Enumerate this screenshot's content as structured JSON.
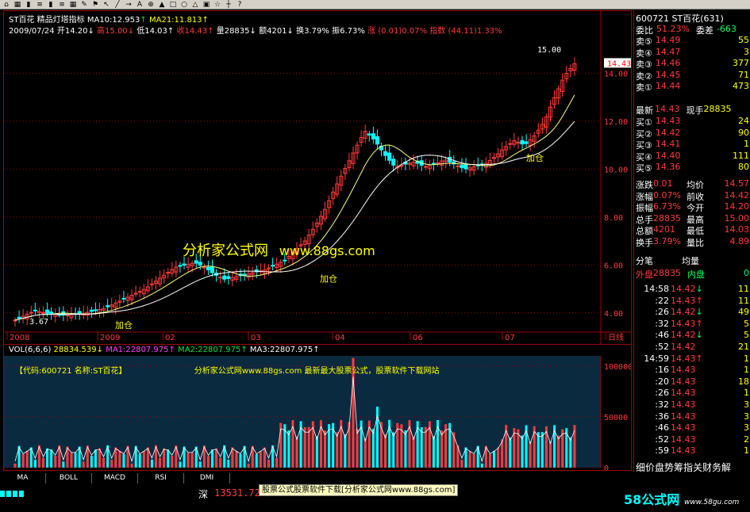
{
  "toolbar": {
    "icons": [
      "home-icon",
      "grid-icon",
      "bars-icon",
      "list-icon",
      "bars-icon",
      "list-icon",
      "grid-icon",
      "pen-icon",
      "flag-icon",
      "cursor-icon",
      "line-icon",
      "arrow-icon",
      "text-icon",
      "zoom-icon",
      "chart-icon",
      "square-icon",
      "circle-icon",
      "tri-icon",
      "lock-icon",
      "star-icon",
      "ruler-icon",
      "help-icon"
    ]
  },
  "header": {
    "stock_name": "ST百花",
    "indicator": "精品灯塔指标",
    "ma10": "MA10:12.953",
    "ma21": "MA21:11.813",
    "date": "2009/07/24",
    "open": "开14.20",
    "high": "高15.00",
    "low": "低14.03",
    "close": "收14.43",
    "volume": "量28835",
    "amount": "额4201",
    "turnover": "换3.79%",
    "amplitude": "振6.73%",
    "change": "涨 (0.01)0.07%",
    "index": "指数 (44.11)1.33%"
  },
  "price_axis": [
    "14.00",
    "12.00",
    "10.00",
    "8.00",
    "6.00",
    "4.00"
  ],
  "price_max_label": "15.00",
  "price_min_label": "3.67",
  "current_price_tag": "14.43",
  "date_axis": [
    "2008",
    "2009",
    "02",
    "03",
    "04",
    "06",
    "07",
    "日线"
  ],
  "add_labels": [
    "加仓",
    "加仓",
    "加仓"
  ],
  "watermark": {
    "cn": "分析家公式网",
    "url": "www.88gs.com"
  },
  "vol_header": {
    "vol": "VOL(6,6,6)",
    "v": "28834.539",
    "ma1": "MA1:22807.975",
    "ma2": "MA2:22807.975",
    "ma3": "MA3:22807.975"
  },
  "vol_info": {
    "code": "【代码:600721 名称:ST百花】",
    "msg": "分析家公式网www.88gs.com 最新最大股票公式，股票软件下载网站"
  },
  "vol_axis": [
    "100000",
    "50000",
    "0"
  ],
  "right_panel": {
    "title": "600721 ST百花(631)",
    "weibi_label": "委比",
    "weibi": "51.23%",
    "weicha_label": "委差",
    "weicha": "-663",
    "sells": [
      {
        "l": "卖⑤",
        "p": "14.49",
        "v": "55"
      },
      {
        "l": "卖④",
        "p": "14.47",
        "v": "3"
      },
      {
        "l": "卖③",
        "p": "14.46",
        "v": "377"
      },
      {
        "l": "卖②",
        "p": "14.45",
        "v": "71"
      },
      {
        "l": "卖①",
        "p": "14.44",
        "v": "473"
      }
    ],
    "latest_label": "最新",
    "latest": "14.43",
    "current_label": "现手",
    "current": "28835",
    "buys": [
      {
        "l": "买①",
        "p": "14.43",
        "v": "24"
      },
      {
        "l": "买②",
        "p": "14.42",
        "v": "90"
      },
      {
        "l": "买③",
        "p": "14.41",
        "v": "1"
      },
      {
        "l": "买④",
        "p": "14.40",
        "v": "111"
      },
      {
        "l": "买⑤",
        "p": "14.36",
        "v": "80"
      }
    ],
    "stats": [
      {
        "a": "涨跌",
        "av": "0.01",
        "b": "均价",
        "bv": "14.57"
      },
      {
        "a": "涨幅",
        "av": "0.07%",
        "b": "前收",
        "bv": "14.42"
      },
      {
        "a": "振幅",
        "av": "6.73%",
        "b": "今开",
        "bv": "14.20"
      },
      {
        "a": "总手",
        "av": "28835",
        "b": "最高",
        "bv": "15.00"
      },
      {
        "a": "总额",
        "av": "4201",
        "b": "最低",
        "bv": "14.03"
      },
      {
        "a": "换手",
        "av": "3.79%",
        "b": "量比",
        "bv": "4.89"
      }
    ],
    "fenbi": "分笔",
    "junliang": "均量",
    "waipan_label": "外盘",
    "waipan": "28835",
    "neipan_label": "内盘",
    "neipan": "0",
    "ticks": [
      {
        "t": "14:58",
        "p": "14.42",
        "d": "down",
        "v": "11"
      },
      {
        "t": ":22",
        "p": "14.43",
        "d": "up",
        "v": "11"
      },
      {
        "t": ":26",
        "p": "14.42",
        "d": "down",
        "v": "49"
      },
      {
        "t": ":32",
        "p": "14.43",
        "d": "up",
        "v": "5"
      },
      {
        "t": ":46",
        "p": "14.42",
        "d": "down",
        "v": "5"
      },
      {
        "t": ":52",
        "p": "14.42",
        "d": "",
        "v": "21"
      },
      {
        "t": "14:59",
        "p": "14.43",
        "d": "up",
        "v": "1"
      },
      {
        "t": ":16",
        "p": "14.43",
        "d": "",
        "v": "1"
      },
      {
        "t": ":20",
        "p": "14.43",
        "d": "",
        "v": "18"
      },
      {
        "t": ":26",
        "p": "14.43",
        "d": "",
        "v": "1"
      },
      {
        "t": ":32",
        "p": "14.43",
        "d": "",
        "v": "3"
      },
      {
        "t": ":36",
        "p": "14.43",
        "d": "",
        "v": "3"
      },
      {
        "t": ":46",
        "p": "14.43",
        "d": "",
        "v": "3"
      },
      {
        "t": ":52",
        "p": "14.43",
        "d": "",
        "v": "2"
      },
      {
        "t": ":59",
        "p": "14.43",
        "d": "",
        "v": "1"
      }
    ],
    "footer": "细价盘势筹指关财务解"
  },
  "tabs": [
    "MA",
    "BOLL",
    "MACD",
    "RSI",
    "DMI"
  ],
  "status": {
    "market": "深",
    "index_val": "13531.72",
    "center_msg": "股票公式股票软件下载[分析家公式网www.88gs.com]",
    "logo": "58公式网",
    "logo_url": "www.58gu.com"
  }
}
